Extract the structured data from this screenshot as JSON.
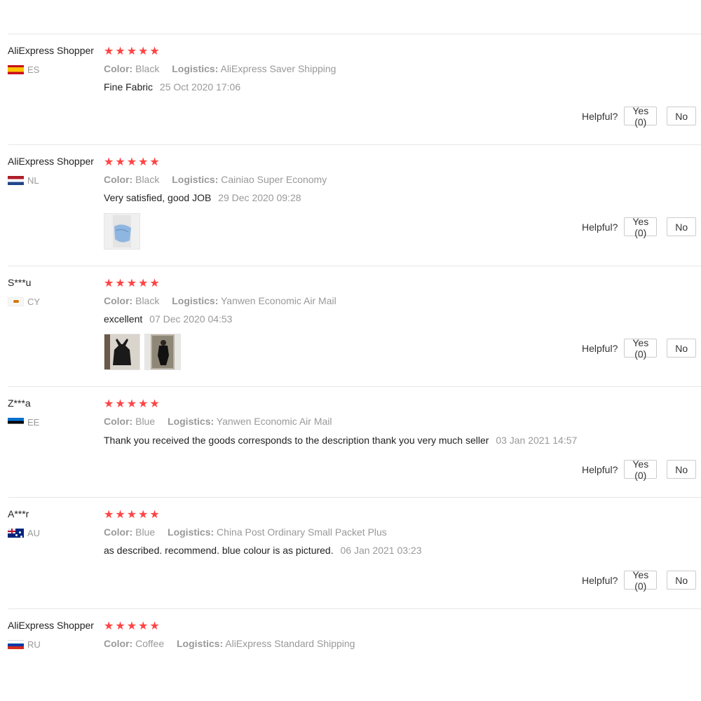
{
  "labels": {
    "color": "Color:",
    "logistics": "Logistics:",
    "helpful": "Helpful?",
    "yes": "Yes (0)",
    "no": "No"
  },
  "colors": {
    "star": "#ff4444",
    "muted": "#999999",
    "divider": "#e6e6e6"
  },
  "reviews": [
    {
      "user": "AliExpress Shopper",
      "country": "ES",
      "rating": 5,
      "color": "Black",
      "logistics": "AliExpress Saver Shipping",
      "feedback": "Fine Fabric",
      "date": "25 Oct 2020 17:06",
      "photos": []
    },
    {
      "user": "AliExpress Shopper",
      "country": "NL",
      "rating": 5,
      "color": "Black",
      "logistics": "Cainiao Super Economy",
      "feedback": "Very satisfied, good JOB",
      "date": "29 Dec 2020 09:28",
      "photos": [
        "mask-photo"
      ]
    },
    {
      "user": "S***u",
      "country": "CY",
      "rating": 5,
      "color": "Black",
      "logistics": "Yanwen Economic Air Mail",
      "feedback": "excellent",
      "date": "07 Dec 2020 04:53",
      "photos": [
        "apron-photo",
        "mirror-selfie-photo"
      ]
    },
    {
      "user": "Z***a",
      "country": "EE",
      "rating": 5,
      "color": "Blue",
      "logistics": "Yanwen Economic Air Mail",
      "feedback": "Thank you received the goods corresponds to the description thank you very much seller",
      "date": "03 Jan 2021 14:57",
      "photos": []
    },
    {
      "user": "A***r",
      "country": "AU",
      "rating": 5,
      "color": "Blue",
      "logistics": "China Post Ordinary Small Packet Plus",
      "feedback": "as described. recommend. blue colour is as pictured.",
      "date": "06 Jan 2021 03:23",
      "photos": []
    },
    {
      "user": "AliExpress Shopper",
      "country": "RU",
      "rating": 5,
      "color": "Coffee",
      "logistics": "AliExpress Standard Shipping",
      "feedback": "",
      "date": "",
      "photos": []
    }
  ]
}
